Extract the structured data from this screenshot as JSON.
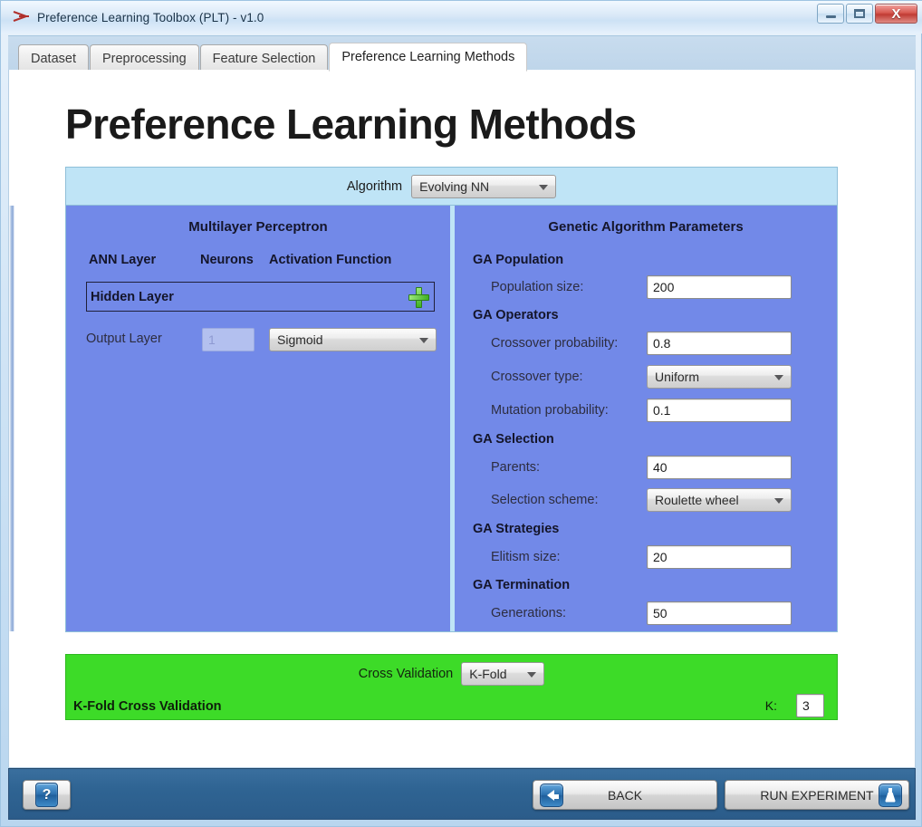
{
  "window": {
    "title": "Preference Learning Toolbox (PLT) - v1.0",
    "app_icon": "plt-logo-icon",
    "controls": {
      "minimize": "minimize-icon",
      "maximize": "maximize-icon",
      "close": "X"
    }
  },
  "tabs": [
    {
      "label": "Dataset",
      "active": false
    },
    {
      "label": "Preprocessing",
      "active": false
    },
    {
      "label": "Feature Selection",
      "active": false
    },
    {
      "label": "Preference Learning Methods",
      "active": true
    }
  ],
  "page": {
    "title": "Preference Learning Methods"
  },
  "algorithm": {
    "label": "Algorithm",
    "selected": "Evolving NN"
  },
  "mlp": {
    "title": "Multilayer Perceptron",
    "columns": [
      "ANN Layer",
      "Neurons",
      "Activation Function"
    ],
    "hidden_layer": {
      "label": "Hidden Layer",
      "add_button": "add-layer-plus-icon"
    },
    "output_layer": {
      "label": "Output Layer",
      "neurons": "1",
      "activation": "Sigmoid"
    }
  },
  "ga": {
    "title": "Genetic Algorithm Parameters",
    "groups": [
      {
        "name": "GA Population",
        "rows": [
          {
            "label": "Population size:",
            "value": "200",
            "type": "text"
          }
        ]
      },
      {
        "name": "GA Operators",
        "rows": [
          {
            "label": "Crossover probability:",
            "value": "0.8",
            "type": "text"
          },
          {
            "label": "Crossover type:",
            "value": "Uniform",
            "type": "combo"
          },
          {
            "label": "Mutation probability:",
            "value": "0.1",
            "type": "text"
          }
        ]
      },
      {
        "name": "GA Selection",
        "rows": [
          {
            "label": "Parents:",
            "value": "40",
            "type": "text"
          },
          {
            "label": "Selection scheme:",
            "value": "Roulette wheel",
            "type": "combo"
          }
        ]
      },
      {
        "name": "GA Strategies",
        "rows": [
          {
            "label": "Elitism size:",
            "value": "20",
            "type": "text"
          }
        ]
      },
      {
        "name": "GA Termination",
        "rows": [
          {
            "label": "Generations:",
            "value": "50",
            "type": "text"
          }
        ]
      }
    ]
  },
  "cross_validation": {
    "label": "Cross Validation",
    "selected": "K-Fold",
    "detail_title": "K-Fold Cross Validation",
    "k_label": "K:",
    "k_value": "3"
  },
  "footer": {
    "help_label": "?",
    "help_icon": "question-mark-icon",
    "back_label": "BACK",
    "back_icon": "arrow-left-icon",
    "run_label": "RUN EXPERIMENT",
    "run_icon": "flask-icon"
  },
  "colors": {
    "title_bar": "#dceaf8",
    "algo_header": "#bfe4f6",
    "panel": "#7289e8",
    "cv_panel": "#3ddb28",
    "footer": "#2f6493",
    "close_button": "#c03a33"
  }
}
